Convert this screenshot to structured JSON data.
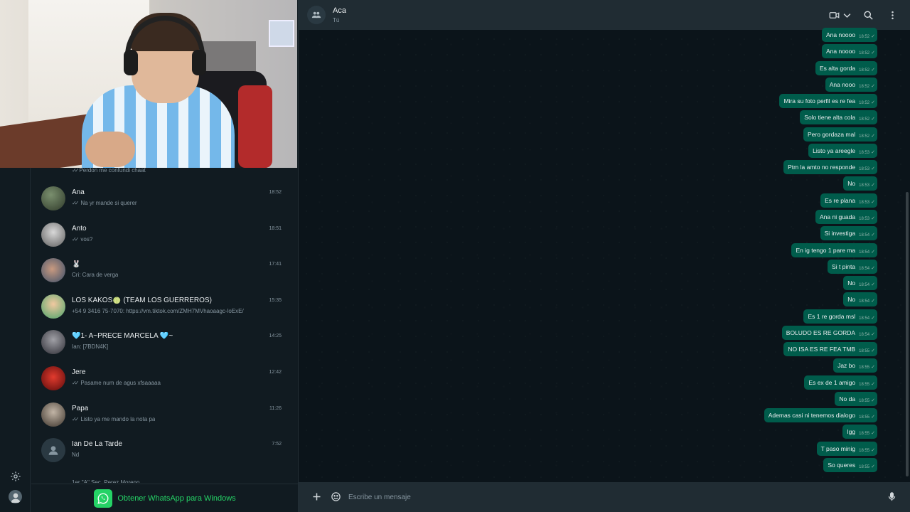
{
  "colors": {
    "accent": "#25d366",
    "bubble_out": "#005c4b",
    "panel": "#202c33",
    "background": "#0b141a"
  },
  "rail": {
    "icons": [
      "settings-icon",
      "profile-avatar"
    ]
  },
  "chat_list": {
    "partial_top_preview": "Perdon me confundi chaat",
    "partial_bottom_name": "1er \"A\" Sec. Perez Moreno",
    "items": [
      {
        "name": "Ana",
        "time": "18:52",
        "preview": "Na yr mande si querer",
        "ticks": true
      },
      {
        "name": "Anto",
        "time": "18:51",
        "preview": "vos?",
        "ticks": true
      },
      {
        "name": "🐰",
        "time": "17:41",
        "preview": "Cri: Cara de verga",
        "ticks": false
      },
      {
        "name": "LOS KAKOS🍈 (TEAM LOS GUERREROS)",
        "time": "15:35",
        "preview": "+54 9 3416 75-7070: https://vm.tiktok.com/ZMH7MVhaoaagc-loExE/",
        "ticks": false
      },
      {
        "name": "🩵1- A~PRECE MARCELA 🩵~",
        "time": "14:25",
        "preview": "Ian: [7BDN4K]",
        "ticks": false
      },
      {
        "name": "Jere",
        "time": "12:42",
        "preview": "Pasame num de agus xfsaaaaa",
        "ticks": true
      },
      {
        "name": "Papa",
        "time": "11:26",
        "preview": "Listo ya me mando la nota pa",
        "ticks": true
      },
      {
        "name": "Ian De La Tarde",
        "time": "7:52",
        "preview": "Nd",
        "ticks": false
      }
    ],
    "promo_label": "Obtener WhatsApp para Windows"
  },
  "conversation": {
    "title": "Aca",
    "subtitle": "Tú",
    "header_icons": [
      "video-call-icon",
      "chevron-down-icon",
      "search-icon",
      "menu-icon"
    ],
    "messages": [
      {
        "text": "Ana noooo",
        "time": "18:52"
      },
      {
        "text": "Ana noooo",
        "time": "18:52"
      },
      {
        "text": "Es alta gorda",
        "time": "18:52"
      },
      {
        "text": "Ana nooo",
        "time": "18:52"
      },
      {
        "text": "Mira su foto perfil es re fea",
        "time": "18:52"
      },
      {
        "text": "Solo tiene alta cola",
        "time": "18:52"
      },
      {
        "text": "Pero gordaza mal",
        "time": "18:52"
      },
      {
        "text": "Listo ya areegle",
        "time": "18:53"
      },
      {
        "text": "Ptm la amto no responde",
        "time": "18:53"
      },
      {
        "text": "No",
        "time": "18:53"
      },
      {
        "text": "Es re plana",
        "time": "18:53"
      },
      {
        "text": "Ana ni guada",
        "time": "18:53"
      },
      {
        "text": "Si investiga",
        "time": "18:54"
      },
      {
        "text": "En ig tengo 1 pare ma",
        "time": "18:54"
      },
      {
        "text": "Si t pinta",
        "time": "18:54"
      },
      {
        "text": "No",
        "time": "18:54"
      },
      {
        "text": "No",
        "time": "18:54"
      },
      {
        "text": "Es 1 re gorda msl",
        "time": "18:54"
      },
      {
        "text": "BOLUDO ES RE GORDA",
        "time": "18:54"
      },
      {
        "text": "NO ISA ES RE FEA TMB",
        "time": "18:55"
      },
      {
        "text": "Jaz bo",
        "time": "18:55"
      },
      {
        "text": "Es ex de 1 amigo",
        "time": "18:55"
      },
      {
        "text": "No da",
        "time": "18:55"
      },
      {
        "text": "Ademas casi ni tenemos dialogo",
        "time": "18:55"
      },
      {
        "text": "Igg",
        "time": "18:55"
      },
      {
        "text": "T paso minig",
        "time": "18:55"
      },
      {
        "text": "So queres",
        "time": "18:55"
      }
    ],
    "composer": {
      "placeholder": "Escribe un mensaje",
      "icons": [
        "plus-icon",
        "sticker-icon",
        "microphone-icon"
      ]
    }
  }
}
